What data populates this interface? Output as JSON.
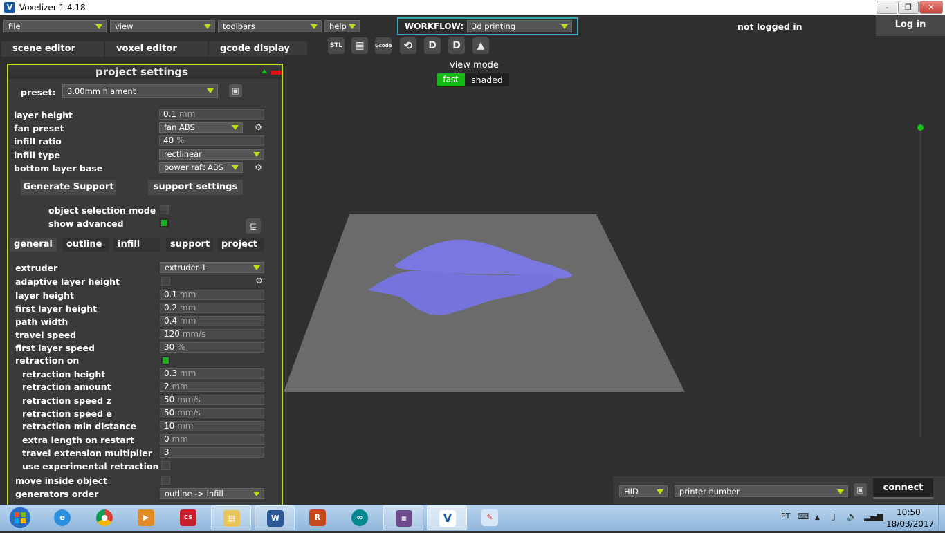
{
  "window": {
    "title": "Voxelizer 1.4.18",
    "minimize": "–",
    "maximize": "❐",
    "close": "✕"
  },
  "menu": {
    "file": "file",
    "view": "view",
    "toolbars": "toolbars",
    "help": "help"
  },
  "workflow": {
    "label": "WORKFLOW:",
    "value": "3d printing"
  },
  "account": {
    "status": "not logged in",
    "login_label": "Log in"
  },
  "tabs": [
    "scene editor",
    "voxel editor",
    "gcode display"
  ],
  "toolbar_icons": [
    {
      "name": "open-stl-icon",
      "glyph": "STL"
    },
    {
      "name": "checker-icon",
      "glyph": "▦"
    },
    {
      "name": "open-gcode-icon",
      "glyph": "Gcode"
    },
    {
      "name": "orbit-icon",
      "glyph": "⟲"
    },
    {
      "name": "drop-d-icon",
      "glyph": "D"
    },
    {
      "name": "drop-d2-icon",
      "glyph": "D"
    },
    {
      "name": "print-icon",
      "glyph": "▲"
    }
  ],
  "view_mode": {
    "label": "view mode",
    "fast": "fast",
    "shaded": "shaded"
  },
  "project": {
    "title": "project settings",
    "preset_label": "preset:",
    "preset_value": "3.00mm filament",
    "basic": [
      {
        "label": "layer height",
        "value": "0.1",
        "unit": "mm"
      },
      {
        "label": "fan preset",
        "value": "fan ABS"
      },
      {
        "label": "infill ratio",
        "value": "40",
        "unit": "%"
      },
      {
        "label": "infill type",
        "value": "rectlinear"
      },
      {
        "label": "bottom layer base",
        "value": "power raft ABS"
      }
    ],
    "generate_support": "Generate Support",
    "support_settings": "support settings",
    "object_selection_mode": "object selection mode",
    "show_advanced": "show advanced",
    "subtabs": [
      "general",
      "outline",
      "infill",
      "support",
      "project"
    ],
    "advanced": {
      "extruder": {
        "label": "extruder",
        "value": "extruder 1"
      },
      "adaptive": "adaptive layer height",
      "rows1": [
        {
          "label": "layer height",
          "value": "0.1",
          "unit": "mm"
        },
        {
          "label": "first layer height",
          "value": "0.2",
          "unit": "mm"
        },
        {
          "label": "path width",
          "value": "0.4",
          "unit": "mm"
        },
        {
          "label": "travel speed",
          "value": "120",
          "unit": "mm/s"
        },
        {
          "label": "first layer speed",
          "value": "30",
          "unit": "%"
        }
      ],
      "retraction_on": "retraction on",
      "rows2": [
        {
          "label": "retraction height",
          "value": "0.3",
          "unit": "mm"
        },
        {
          "label": "retraction amount",
          "value": "2",
          "unit": "mm"
        },
        {
          "label": "retraction speed z",
          "value": "50",
          "unit": "mm/s"
        },
        {
          "label": "retraction speed e",
          "value": "50",
          "unit": "mm/s"
        },
        {
          "label": "retraction min distance",
          "value": "10",
          "unit": "mm"
        },
        {
          "label": "extra length on restart",
          "value": "0",
          "unit": "mm"
        },
        {
          "label": "travel extension multiplier",
          "value": "3",
          "unit": ""
        }
      ],
      "experimental": "use experimental retraction",
      "move_inside": "move inside object",
      "generators": {
        "label": "generators order",
        "value": "outline -> infill"
      }
    }
  },
  "connection": {
    "port": "HID",
    "printer": "printer number",
    "connect": "connect"
  },
  "taskbar": {
    "lang": "PT",
    "time": "10:50",
    "date": "18/03/2017"
  }
}
